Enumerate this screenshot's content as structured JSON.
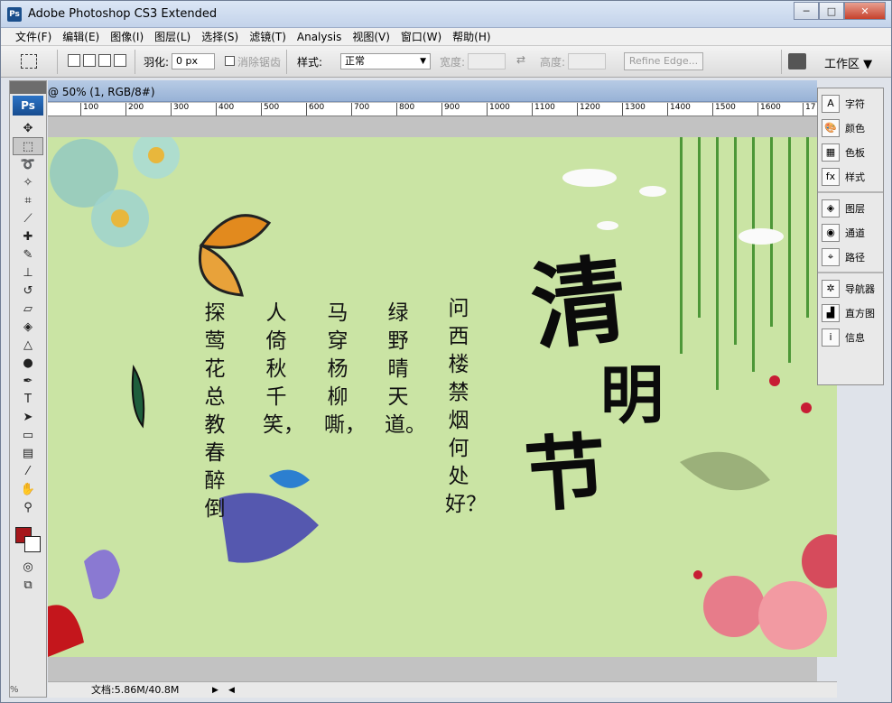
{
  "window": {
    "app_badge": "Ps",
    "title": "Adobe Photoshop CS3 Extended",
    "minimize": "─",
    "maximize": "□",
    "close": "✕"
  },
  "menu": [
    "文件(F)",
    "编辑(E)",
    "图像(I)",
    "图层(L)",
    "选择(S)",
    "滤镜(T)",
    "Analysis",
    "视图(V)",
    "窗口(W)",
    "帮助(H)"
  ],
  "options": {
    "feather_label": "羽化:",
    "feather_value": "0 px",
    "antialias_label": "消除锯齿",
    "style_label": "样式:",
    "style_value": "正常",
    "width_label": "宽度:",
    "height_label": "高度:",
    "refine_edge": "Refine Edge...",
    "workspace": "工作区 ▼"
  },
  "toolbox": {
    "badge": "Ps"
  },
  "document": {
    "tab_title": "@ 50% (1, RGB/8#)",
    "ruler_labels": [
      "100",
      "200",
      "300",
      "400",
      "500",
      "600",
      "700",
      "800",
      "900",
      "1000",
      "1100",
      "1200",
      "1300",
      "1400",
      "1500",
      "1600",
      "17"
    ],
    "status_left": "%",
    "status": "文档:5.86M/40.8M"
  },
  "artwork": {
    "title_chars": [
      "清",
      "明",
      "节"
    ],
    "poem_columns": [
      "问西楼禁烟何处好？",
      "绿野晴天道。",
      "马穿杨柳嘶，",
      "人倚秋千笑，",
      "探莺花总教春醉倒"
    ]
  },
  "panels": [
    [
      {
        "icon": "A",
        "label": "字符"
      },
      {
        "icon": "🎨",
        "label": "颜色"
      },
      {
        "icon": "▦",
        "label": "色板"
      },
      {
        "icon": "fx",
        "label": "样式"
      }
    ],
    [
      {
        "icon": "◈",
        "label": "图层"
      },
      {
        "icon": "◉",
        "label": "通道"
      },
      {
        "icon": "⌖",
        "label": "路径"
      }
    ],
    [
      {
        "icon": "✲",
        "label": "导航器"
      },
      {
        "icon": "▟",
        "label": "直方图"
      },
      {
        "icon": "i",
        "label": "信息"
      }
    ]
  ],
  "colors": {
    "foreground": "#a6171b",
    "background": "#ffffff",
    "canvas_bg": "#cae4a4"
  }
}
